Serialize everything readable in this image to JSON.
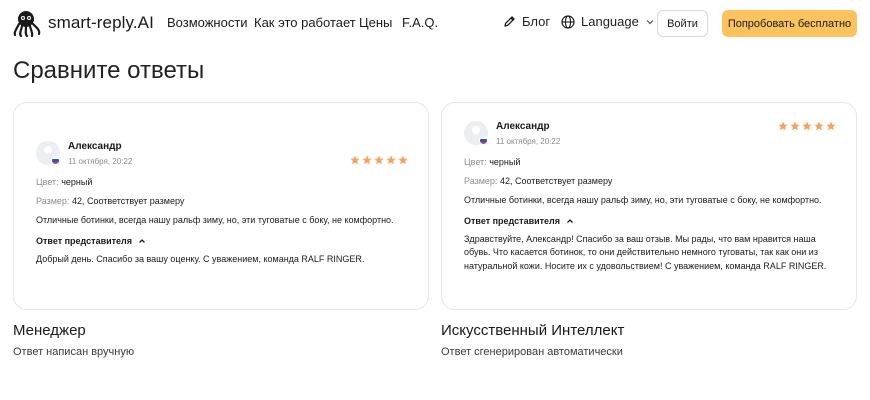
{
  "nav": {
    "brand": "smart-reply.AI",
    "links": [
      "Возможности",
      "Как это работает",
      "Цены",
      "F.A.Q."
    ],
    "blog": "Блог",
    "language": "Language",
    "login": "Войти",
    "try_free": "Попробовать бесплатно"
  },
  "page_title": "Сравните ответы",
  "review": {
    "name": "Александр",
    "date": "11 октября, 20:22",
    "color_label": "Цвет:",
    "color_value": "черный",
    "size_label": "Размер:",
    "size_value": "42, Соответствует размеру",
    "text": "Отличные ботинки, всегда нашу ральф зиму, но, эти туговатые с боку, не комфортно.",
    "rating": 5,
    "star_color": "#f5a25d"
  },
  "response_label": "Ответ представителя",
  "manager": {
    "response": "Добрый день. Спасибо за вашу оценку. С уважением, команда RALF RINGER.",
    "title": "Менеджер",
    "subtitle": "Ответ написан вручную"
  },
  "ai": {
    "response": "Здравствуйте, Александр! Спасибо за ваш отзыв. Мы рады, что вам нравится наша обувь. Что касается ботинок, то они действительно немного туговаты, так как они из натуральной кожи. Носите их с удовольствием! С уважением, команда RALF RINGER.",
    "title": "Искусственный Интеллект",
    "subtitle": "Ответ сгенерирован автоматически"
  },
  "colors": {
    "accent_button": "#fbc25e",
    "card_border": "#e6e6e6"
  }
}
